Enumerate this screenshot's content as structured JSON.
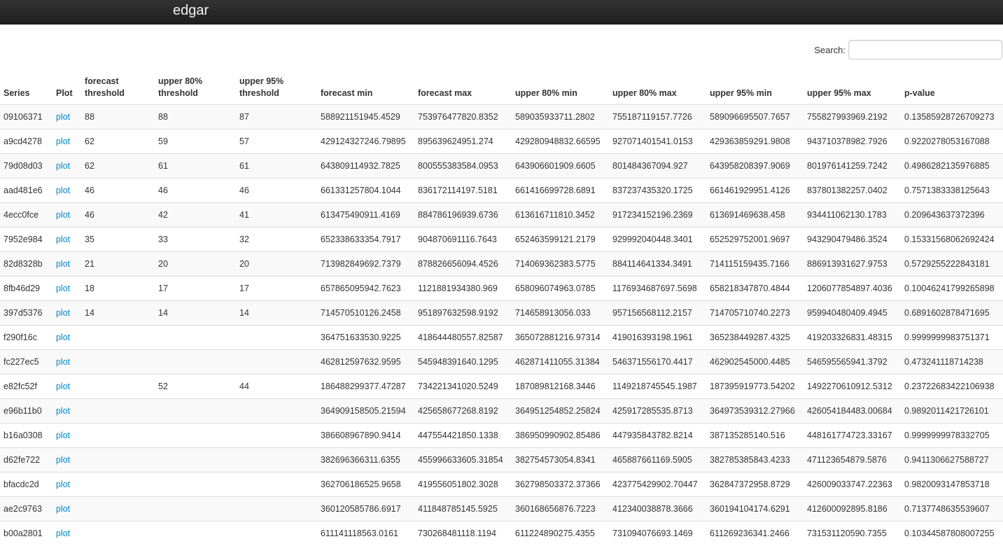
{
  "app": {
    "title": "edgar"
  },
  "search": {
    "label": "Search:",
    "value": ""
  },
  "table": {
    "headers": {
      "series": "Series",
      "plot": "Plot",
      "forecast_threshold": [
        "forecast",
        "threshold"
      ],
      "upper80_threshold": [
        "upper 80%",
        "threshold"
      ],
      "upper95_threshold": [
        "upper 95%",
        "threshold"
      ],
      "forecast_min": "forecast min",
      "forecast_max": "forecast max",
      "upper80_min": "upper 80% min",
      "upper80_max": "upper 80% max",
      "upper95_min": "upper 95% min",
      "upper95_max": "upper 95% max",
      "p_value": "p-value"
    },
    "plot_label": "plot",
    "rows": [
      [
        "09106371",
        "88",
        "88",
        "87",
        "588921151945.4529",
        "753976477820.8352",
        "589035933711.2802",
        "755187119157.7726",
        "589096695507.7657",
        "755827993969.2192",
        "0.13585928726709273"
      ],
      [
        "a9cd4278",
        "62",
        "59",
        "57",
        "429124327246.79895",
        "895639624951.274",
        "429280948832.66595",
        "927071401541.0153",
        "429363859291.9808",
        "943710378982.7926",
        "0.9220278053167088"
      ],
      [
        "79d08d03",
        "62",
        "61",
        "61",
        "643809114932.7825",
        "800555383584.0953",
        "643906601909.6605",
        "801484367094.927",
        "643958208397.9069",
        "801976141259.7242",
        "0.4986282135976885"
      ],
      [
        "aad481e6",
        "46",
        "46",
        "46",
        "661331257804.1044",
        "836172114197.5181",
        "661416699728.6891",
        "837237435320.1725",
        "661461929951.4126",
        "837801382257.0402",
        "0.7571383338125643"
      ],
      [
        "4ecc0fce",
        "46",
        "42",
        "41",
        "613475490911.4169",
        "884786196939.6736",
        "613616711810.3452",
        "917234152196.2369",
        "613691469638.458",
        "934411062130.1783",
        "0.209643637372396"
      ],
      [
        "7952e984",
        "35",
        "33",
        "32",
        "652338633354.7917",
        "904870691116.7643",
        "652463599121.2179",
        "929992040448.3401",
        "652529752001.9697",
        "943290479486.3524",
        "0.15331568062692424"
      ],
      [
        "82d8328b",
        "21",
        "20",
        "20",
        "713982849692.7379",
        "878826656094.4526",
        "714069362383.5775",
        "884114641334.3491",
        "714115159435.7166",
        "886913931627.9753",
        "0.5729255222843181"
      ],
      [
        "8fb46d29",
        "18",
        "17",
        "17",
        "657865095942.7623",
        "1121881934380.969",
        "658096074963.0785",
        "1176934687697.5698",
        "658218347870.4844",
        "1206077854897.4036",
        "0.10046241799265898"
      ],
      [
        "397d5376",
        "14",
        "14",
        "14",
        "714570510126.2458",
        "951897632598.9192",
        "714658913056.033",
        "957156568112.2157",
        "714705710740.2273",
        "959940480409.4945",
        "0.6891602878471695"
      ],
      [
        "f290f16c",
        "",
        "",
        "",
        "364751633530.9225",
        "418644480557.82587",
        "365072881216.97314",
        "419016393198.1961",
        "365238449287.4325",
        "419203326831.48315",
        "0.9999999983751371"
      ],
      [
        "fc227ec5",
        "",
        "",
        "",
        "462812597632.9595",
        "545948391640.1295",
        "462871411055.31384",
        "546371556170.4417",
        "462902545000.4485",
        "546595565941.3792",
        "0.473241118714238"
      ],
      [
        "e82fc52f",
        "",
        "52",
        "44",
        "186488299377.47287",
        "734221341020.5249",
        "187089812168.3446",
        "1149218745545.1987",
        "187395919773.54202",
        "1492270610912.5312",
        "0.23722683422106938"
      ],
      [
        "e96b11b0",
        "",
        "",
        "",
        "364909158505.21594",
        "425658677268.8192",
        "364951254852.25824",
        "425917285535.8713",
        "364973539312.27966",
        "426054184483.00684",
        "0.9892011421726101"
      ],
      [
        "b16a0308",
        "",
        "",
        "",
        "386608967890.9414",
        "447554421850.1338",
        "386950990902.85486",
        "447935843782.8214",
        "387135285140.516",
        "448161774723.33167",
        "0.9999999978332705"
      ],
      [
        "d62fe722",
        "",
        "",
        "",
        "382696366311.6355",
        "455996633605.31854",
        "382754573054.8341",
        "465887661169.5905",
        "382785385843.4233",
        "471123654879.5876",
        "0.9411306627588727"
      ],
      [
        "bfacdc2d",
        "",
        "",
        "",
        "362706186525.9658",
        "419556051802.3028",
        "362798503372.37366",
        "423775429902.70447",
        "362847372958.8729",
        "426009033747.22363",
        "0.9820093147853718"
      ],
      [
        "ae2c9763",
        "",
        "",
        "",
        "360120585786.6917",
        "411848785145.5925",
        "360168656876.7223",
        "412340038878.3666",
        "360194104174.6291",
        "412600092895.8186",
        "0.7137748635539607"
      ],
      [
        "b00a2801",
        "",
        "",
        "",
        "611141118563.0161",
        "730268481118.1194",
        "611224890275.4355",
        "731094076693.1469",
        "611269236341.2466",
        "731531120590.7355",
        "0.10344587808007255"
      ]
    ]
  }
}
